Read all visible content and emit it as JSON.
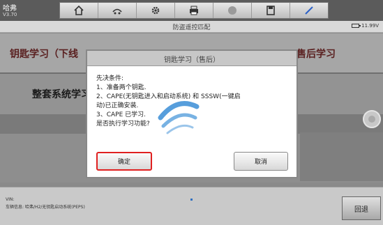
{
  "app": {
    "title": "哈弗",
    "version": "V3.70"
  },
  "toolbar": {
    "icons": [
      "home-icon",
      "car-link-icon",
      "gear-icon",
      "printer-icon",
      "help-icon",
      "save-icon",
      "pen-icon"
    ]
  },
  "subbar": {
    "title": "防盗遥控匹配",
    "battery": "11.99V"
  },
  "menu": {
    "key_learn": "钥匙学习（下线",
    "after_sale": "售后学习",
    "full_system": "整套系统学习"
  },
  "dialog": {
    "title": "钥匙学习（售后）",
    "lines": [
      "先决条件:",
      "1、准备两个钥匙.",
      "2、CAPE(无钥匙进入和启动系统) 和 SSSW(一键启",
      "动)已正确安装.",
      "3、CAPE 已学习.",
      "是否执行学习功能?"
    ],
    "ok_label": "确定",
    "cancel_label": "取消"
  },
  "bottom": {
    "vin": "VIN:",
    "vehicle_info": "车辆信息: 哈弗/H2/无钥匙启动系统(PEPS)",
    "back_label": "回退"
  },
  "colors": {
    "ok_highlight": "#e02020",
    "watermark": "#3a8ed6"
  }
}
